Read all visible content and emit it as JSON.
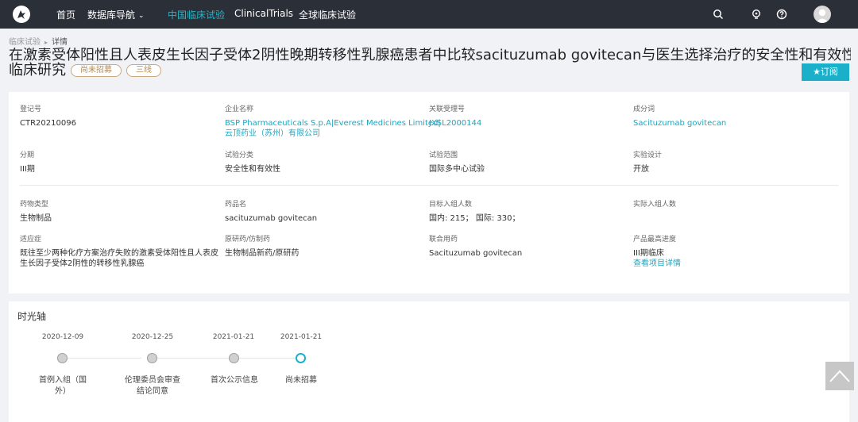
{
  "nav": {
    "items": [
      {
        "label": "首页"
      },
      {
        "label": "数据库导航"
      },
      {
        "label": "中国临床试验"
      },
      {
        "label": "ClinicalTrials"
      },
      {
        "label": "全球临床试验"
      }
    ],
    "caret": "⌄"
  },
  "breadcrumb": {
    "parent": "临床试验",
    "sep": "▸",
    "current": "详情"
  },
  "title": {
    "line1": "在激素受体阳性且人表皮生长因子受体2阴性晚期转移性乳腺癌患者中比较sacituzumab govitecan与医生选择治疗的安全性和有效性",
    "line2": "临床研究",
    "tags": [
      "尚未招募",
      "三线"
    ]
  },
  "subscribe_label": "★订阅",
  "info": {
    "reg_no": {
      "label": "登记号",
      "value": "CTR20210096"
    },
    "company": {
      "label": "企业名称",
      "value": "BSP Pharmaceuticals S.p.A|Everest Medicines Limited|",
      "value2": "云顶药业（苏州）有限公司"
    },
    "acceptance_no": {
      "label": "关联受理号",
      "value": "JXSL2000144"
    },
    "ingredient": {
      "label": "成分词",
      "value": "Sacituzumab govitecan"
    },
    "phase": {
      "label": "分期",
      "value": "III期"
    },
    "trial_type": {
      "label": "试验分类",
      "value": "安全性和有效性"
    },
    "scope": {
      "label": "试验范围",
      "value": "国际多中心试验"
    },
    "design": {
      "label": "实验设计",
      "value": "开放"
    },
    "drug_type": {
      "label": "药物类型",
      "value": "生物制品"
    },
    "drug_name": {
      "label": "药品名",
      "value": "sacituzumab govitecan"
    },
    "target_enroll": {
      "label": "目标入组人数",
      "value": "国内: 215；  国际: 330；"
    },
    "actual_enroll": {
      "label": "实际入组人数",
      "value": ""
    },
    "indication": {
      "label": "适应症",
      "value": "既往至少两种化疗方案治疗失败的激素受体阳性且人表皮生长因子受体2阴性的转移性乳腺癌"
    },
    "origin": {
      "label": "原研药/仿制药",
      "value": "生物制品新药/原研药"
    },
    "combo": {
      "label": "联合用药",
      "value": "Sacituzumab govitecan"
    },
    "progress": {
      "label": "产品最高进度",
      "value": "III期临床",
      "link": "查看项目详情"
    }
  },
  "timeline": {
    "title": "时光轴",
    "events": [
      {
        "date": "2020-12-09",
        "label": "首例入组（国外）",
        "current": false
      },
      {
        "date": "2020-12-25",
        "label": "伦理委员会审查结论同意",
        "current": false
      },
      {
        "date": "2021-01-21",
        "label": "首次公示信息",
        "current": false
      },
      {
        "date": "2021-01-21",
        "label": "尚未招募",
        "current": true
      }
    ]
  },
  "colors": {
    "accent": "#1bb0c9",
    "nav_bg": "#2b2f38",
    "tag": "#b58b50"
  }
}
